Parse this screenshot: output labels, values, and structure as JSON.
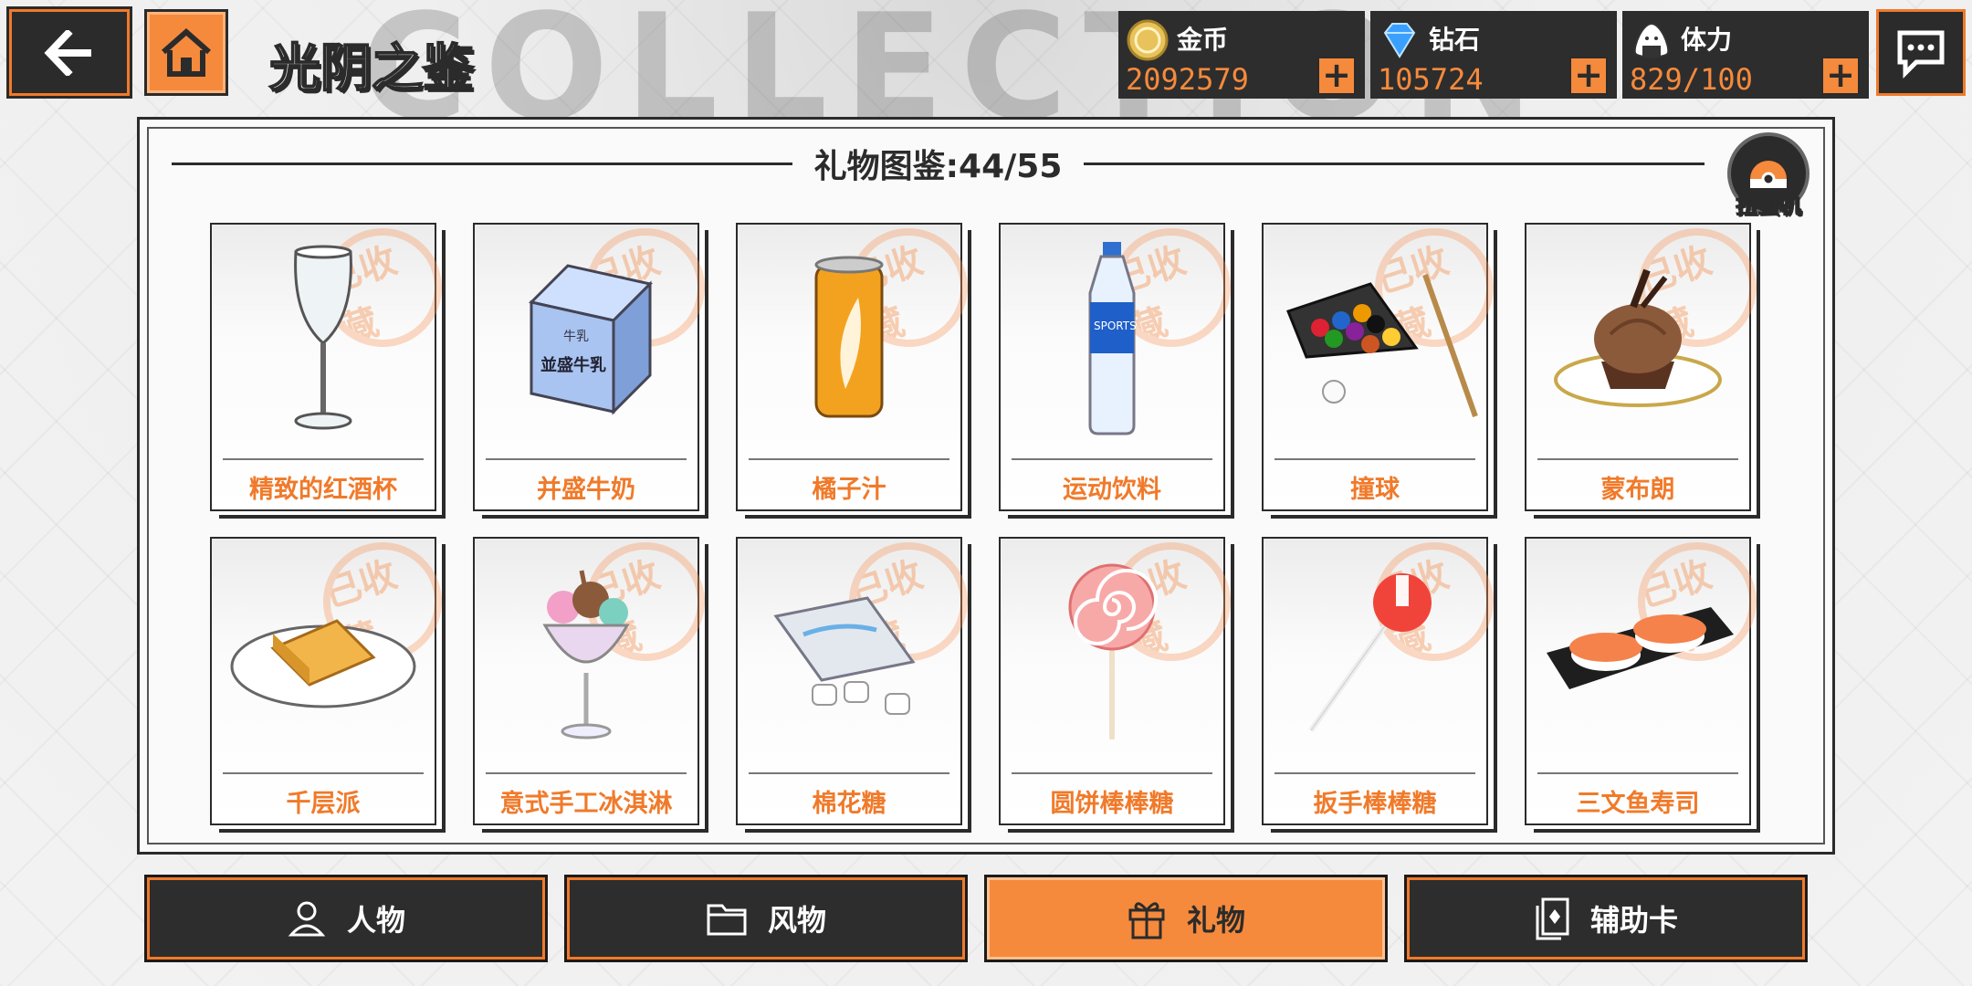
{
  "header": {
    "watermark": "COLLECTION",
    "title": "光阴之鉴"
  },
  "resources": [
    {
      "name": "金币",
      "value": "2092579",
      "icon": "gold-coin-icon"
    },
    {
      "name": "钻石",
      "value": "105724",
      "icon": "diamond-icon"
    },
    {
      "name": "体力",
      "value": "829/100",
      "icon": "onigiri-icon"
    }
  ],
  "panel": {
    "title": "礼物图鉴:44/55",
    "gacha_label": "扭蛋机",
    "stamp_text": "已收藏"
  },
  "items": [
    {
      "name": "精致的红酒杯",
      "icon": "wine-glass-icon"
    },
    {
      "name": "并盛牛奶",
      "icon": "milk-carton-icon"
    },
    {
      "name": "橘子汁",
      "icon": "orange-can-icon"
    },
    {
      "name": "运动饮料",
      "icon": "sports-drink-icon"
    },
    {
      "name": "撞球",
      "icon": "billiards-icon"
    },
    {
      "name": "蒙布朗",
      "icon": "mont-blanc-icon"
    },
    {
      "name": "千层派",
      "icon": "mille-feuille-icon"
    },
    {
      "name": "意式手工冰淇淋",
      "icon": "gelato-icon"
    },
    {
      "name": "棉花糖",
      "icon": "marshmallow-icon"
    },
    {
      "name": "圆饼棒棒糖",
      "icon": "swirl-lollipop-icon"
    },
    {
      "name": "扳手棒棒糖",
      "icon": "wrench-lollipop-icon"
    },
    {
      "name": "三文鱼寿司",
      "icon": "salmon-sushi-icon"
    }
  ],
  "item_art_labels": {
    "milk_logo": "牛乳",
    "milk_brand": "並盛牛乳",
    "sports_label": "SPORTS"
  },
  "tabs": [
    {
      "label": "人物",
      "icon": "person-icon",
      "active": false
    },
    {
      "label": "风物",
      "icon": "folder-icon",
      "active": false
    },
    {
      "label": "礼物",
      "icon": "gift-icon",
      "active": true
    },
    {
      "label": "辅助卡",
      "icon": "card-icon",
      "active": false
    }
  ],
  "colors": {
    "accent": "#f58a3c",
    "dark": "#2b2b2b"
  }
}
